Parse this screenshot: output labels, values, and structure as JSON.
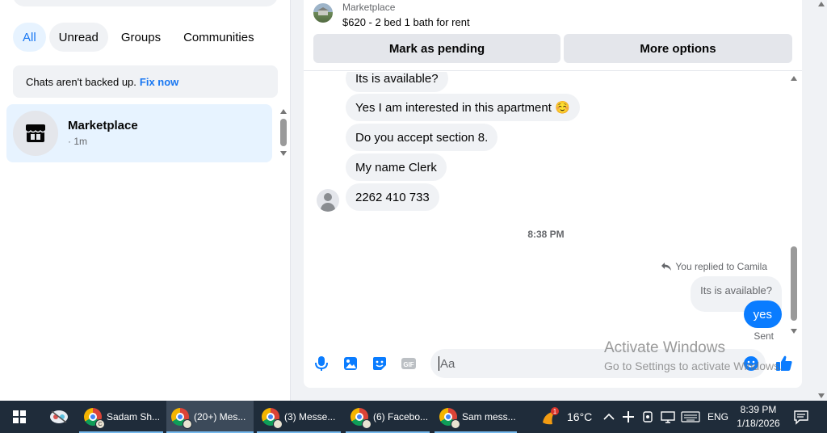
{
  "left": {
    "filters": [
      "All",
      "Unread",
      "Groups",
      "Communities"
    ],
    "notice": {
      "text": "Chats aren't backed up.",
      "link": "Fix now"
    },
    "chats": [
      {
        "name": "Marketplace",
        "time": "· 1m"
      }
    ]
  },
  "conversation": {
    "listing": {
      "category": "Marketplace",
      "title": "$620 - 2 bed 1 bath for rent"
    },
    "buttons": {
      "pending": "Mark as pending",
      "more": "More options"
    },
    "incoming": [
      "Its is available?",
      "Yes I am interested in this apartment ☺️",
      "Do you accept section 8.",
      "My name Clerk",
      "2262 410 733"
    ],
    "timestamp": "8:38 PM",
    "replied_to": "You replied to Camila",
    "quoted": "Its is available?",
    "outgoing": "yes",
    "status": "Sent",
    "composer_placeholder": "Aa"
  },
  "watermark": {
    "line1": "Activate Windows",
    "line2": "Go to Settings to activate Windows."
  },
  "taskbar": {
    "apps": [
      {
        "label": "Sadam Sh...",
        "badge": "C"
      },
      {
        "label": "(20+) Mes...",
        "badge": ""
      },
      {
        "label": "(3) Messe...",
        "badge": ""
      },
      {
        "label": "(6) Facebo...",
        "badge": ""
      },
      {
        "label": "Sam mess...",
        "badge": ""
      }
    ],
    "weather": {
      "temp": "16°C",
      "alerts": "1"
    },
    "lang": "ENG",
    "time": "8:39 PM",
    "date": "1/18/2026"
  },
  "colors": {
    "accent": "#1877f2",
    "outgoing_bubble": "#0a7cff",
    "taskbar": "#1f2c3a"
  }
}
